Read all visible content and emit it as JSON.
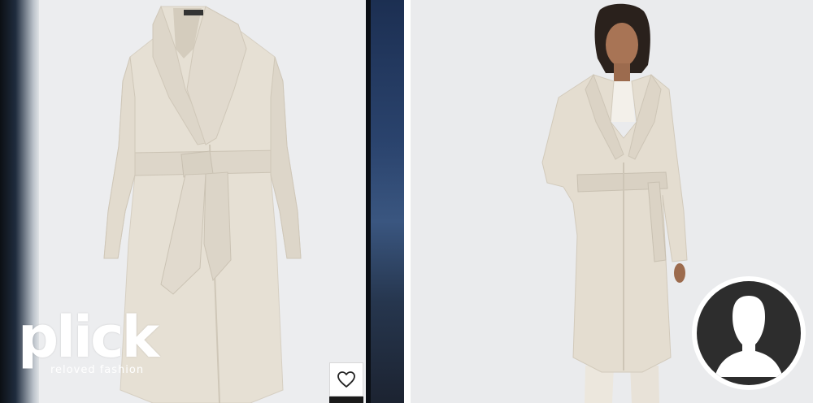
{
  "brand": {
    "logo_word": "plick",
    "tagline": "reloved fashion"
  },
  "product": {
    "color": "#e6e0d4",
    "shadow_color": "#cfc7b8"
  },
  "icons": {
    "favorite": "heart-icon",
    "seller_avatar": "user-silhouette-icon"
  },
  "colors": {
    "background_left": "#ecedef",
    "background_right": "#eaebed",
    "avatar_bg": "#2d2d2d"
  }
}
